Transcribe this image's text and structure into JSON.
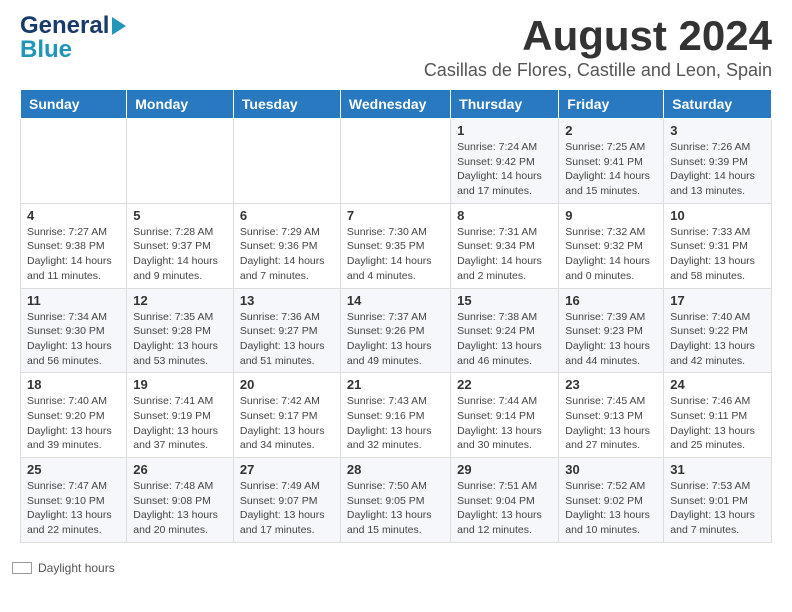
{
  "header": {
    "logo_line1": "General",
    "logo_line2": "Blue",
    "main_title": "August 2024",
    "subtitle": "Casillas de Flores, Castille and Leon, Spain"
  },
  "calendar": {
    "days_of_week": [
      "Sunday",
      "Monday",
      "Tuesday",
      "Wednesday",
      "Thursday",
      "Friday",
      "Saturday"
    ],
    "weeks": [
      [
        {
          "day": "",
          "info": ""
        },
        {
          "day": "",
          "info": ""
        },
        {
          "day": "",
          "info": ""
        },
        {
          "day": "",
          "info": ""
        },
        {
          "day": "1",
          "info": "Sunrise: 7:24 AM\nSunset: 9:42 PM\nDaylight: 14 hours and 17 minutes."
        },
        {
          "day": "2",
          "info": "Sunrise: 7:25 AM\nSunset: 9:41 PM\nDaylight: 14 hours and 15 minutes."
        },
        {
          "day": "3",
          "info": "Sunrise: 7:26 AM\nSunset: 9:39 PM\nDaylight: 14 hours and 13 minutes."
        }
      ],
      [
        {
          "day": "4",
          "info": "Sunrise: 7:27 AM\nSunset: 9:38 PM\nDaylight: 14 hours and 11 minutes."
        },
        {
          "day": "5",
          "info": "Sunrise: 7:28 AM\nSunset: 9:37 PM\nDaylight: 14 hours and 9 minutes."
        },
        {
          "day": "6",
          "info": "Sunrise: 7:29 AM\nSunset: 9:36 PM\nDaylight: 14 hours and 7 minutes."
        },
        {
          "day": "7",
          "info": "Sunrise: 7:30 AM\nSunset: 9:35 PM\nDaylight: 14 hours and 4 minutes."
        },
        {
          "day": "8",
          "info": "Sunrise: 7:31 AM\nSunset: 9:34 PM\nDaylight: 14 hours and 2 minutes."
        },
        {
          "day": "9",
          "info": "Sunrise: 7:32 AM\nSunset: 9:32 PM\nDaylight: 14 hours and 0 minutes."
        },
        {
          "day": "10",
          "info": "Sunrise: 7:33 AM\nSunset: 9:31 PM\nDaylight: 13 hours and 58 minutes."
        }
      ],
      [
        {
          "day": "11",
          "info": "Sunrise: 7:34 AM\nSunset: 9:30 PM\nDaylight: 13 hours and 56 minutes."
        },
        {
          "day": "12",
          "info": "Sunrise: 7:35 AM\nSunset: 9:28 PM\nDaylight: 13 hours and 53 minutes."
        },
        {
          "day": "13",
          "info": "Sunrise: 7:36 AM\nSunset: 9:27 PM\nDaylight: 13 hours and 51 minutes."
        },
        {
          "day": "14",
          "info": "Sunrise: 7:37 AM\nSunset: 9:26 PM\nDaylight: 13 hours and 49 minutes."
        },
        {
          "day": "15",
          "info": "Sunrise: 7:38 AM\nSunset: 9:24 PM\nDaylight: 13 hours and 46 minutes."
        },
        {
          "day": "16",
          "info": "Sunrise: 7:39 AM\nSunset: 9:23 PM\nDaylight: 13 hours and 44 minutes."
        },
        {
          "day": "17",
          "info": "Sunrise: 7:40 AM\nSunset: 9:22 PM\nDaylight: 13 hours and 42 minutes."
        }
      ],
      [
        {
          "day": "18",
          "info": "Sunrise: 7:40 AM\nSunset: 9:20 PM\nDaylight: 13 hours and 39 minutes."
        },
        {
          "day": "19",
          "info": "Sunrise: 7:41 AM\nSunset: 9:19 PM\nDaylight: 13 hours and 37 minutes."
        },
        {
          "day": "20",
          "info": "Sunrise: 7:42 AM\nSunset: 9:17 PM\nDaylight: 13 hours and 34 minutes."
        },
        {
          "day": "21",
          "info": "Sunrise: 7:43 AM\nSunset: 9:16 PM\nDaylight: 13 hours and 32 minutes."
        },
        {
          "day": "22",
          "info": "Sunrise: 7:44 AM\nSunset: 9:14 PM\nDaylight: 13 hours and 30 minutes."
        },
        {
          "day": "23",
          "info": "Sunrise: 7:45 AM\nSunset: 9:13 PM\nDaylight: 13 hours and 27 minutes."
        },
        {
          "day": "24",
          "info": "Sunrise: 7:46 AM\nSunset: 9:11 PM\nDaylight: 13 hours and 25 minutes."
        }
      ],
      [
        {
          "day": "25",
          "info": "Sunrise: 7:47 AM\nSunset: 9:10 PM\nDaylight: 13 hours and 22 minutes."
        },
        {
          "day": "26",
          "info": "Sunrise: 7:48 AM\nSunset: 9:08 PM\nDaylight: 13 hours and 20 minutes."
        },
        {
          "day": "27",
          "info": "Sunrise: 7:49 AM\nSunset: 9:07 PM\nDaylight: 13 hours and 17 minutes."
        },
        {
          "day": "28",
          "info": "Sunrise: 7:50 AM\nSunset: 9:05 PM\nDaylight: 13 hours and 15 minutes."
        },
        {
          "day": "29",
          "info": "Sunrise: 7:51 AM\nSunset: 9:04 PM\nDaylight: 13 hours and 12 minutes."
        },
        {
          "day": "30",
          "info": "Sunrise: 7:52 AM\nSunset: 9:02 PM\nDaylight: 13 hours and 10 minutes."
        },
        {
          "day": "31",
          "info": "Sunrise: 7:53 AM\nSunset: 9:01 PM\nDaylight: 13 hours and 7 minutes."
        }
      ]
    ]
  },
  "legend": {
    "label": "Daylight hours"
  }
}
